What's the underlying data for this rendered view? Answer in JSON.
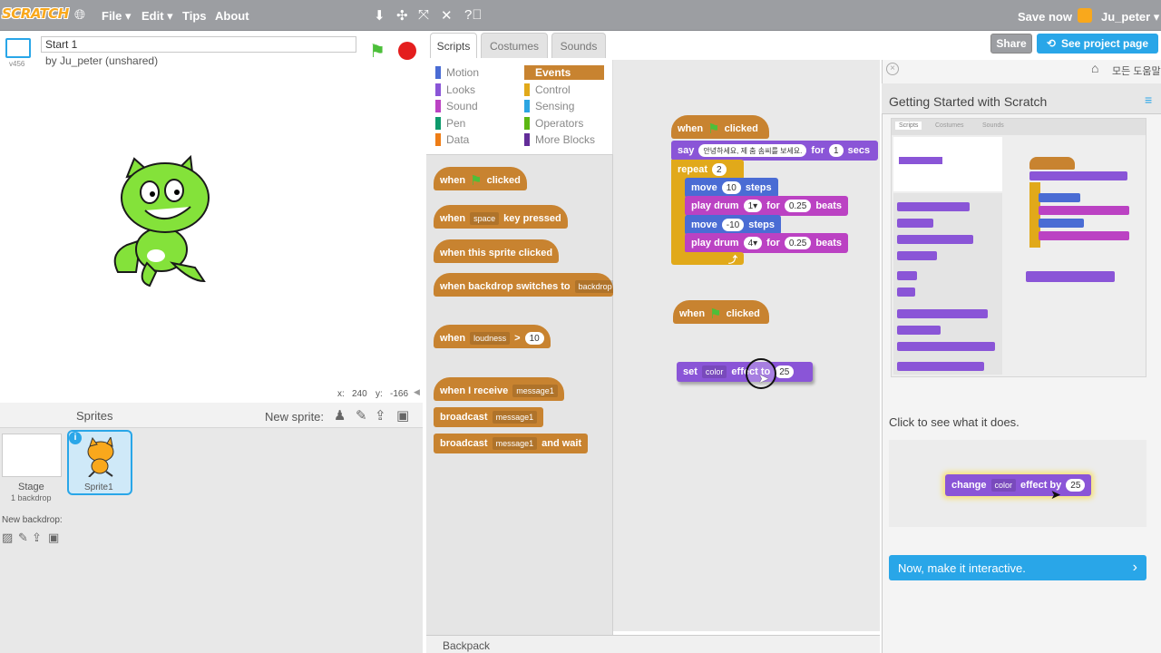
{
  "topbar": {
    "logo": "SCRATCH",
    "menus": [
      "File ▾",
      "Edit ▾",
      "Tips",
      "About"
    ],
    "save_now": "Save now",
    "username": "Ju_peter ▾"
  },
  "project": {
    "title_value": "Start 1",
    "byline": "by Ju_peter (unshared)",
    "version": "v456",
    "share_label": "Share",
    "see_project_label": "See project page"
  },
  "stage": {
    "x_label": "x:",
    "x_value": "240",
    "y_label": "y:",
    "y_value": "-166"
  },
  "sprites": {
    "header": "Sprites",
    "new_sprite": "New sprite:",
    "stage_label": "Stage",
    "stage_sub": "1 backdrop",
    "new_backdrop": "New backdrop:",
    "sprite1": "Sprite1"
  },
  "tabs": [
    "Scripts",
    "Costumes",
    "Sounds"
  ],
  "categories": {
    "left": [
      {
        "label": "Motion",
        "color": "#4a6cd4"
      },
      {
        "label": "Looks",
        "color": "#8a55d7"
      },
      {
        "label": "Sound",
        "color": "#bb42c3"
      },
      {
        "label": "Pen",
        "color": "#0e9a6c"
      },
      {
        "label": "Data",
        "color": "#ee7d16"
      }
    ],
    "right": [
      {
        "label": "Events",
        "color": "#c88330"
      },
      {
        "label": "Control",
        "color": "#e1a91a"
      },
      {
        "label": "Sensing",
        "color": "#2ca5e2"
      },
      {
        "label": "Operators",
        "color": "#5cb712"
      },
      {
        "label": "More Blocks",
        "color": "#632d99"
      }
    ]
  },
  "palette": {
    "when": "when",
    "clicked": "clicked",
    "space": "space",
    "key_pressed": "key pressed",
    "this_sprite_clicked": "when this sprite clicked",
    "backdrop_switches": "when backdrop switches to",
    "backdrop": "backdrop",
    "loudness": "loudness",
    "gt": ">",
    "ten": "10",
    "when_i_receive": "when I receive",
    "message1": "message1",
    "broadcast": "broadcast",
    "and_wait": "and wait"
  },
  "script": {
    "say": "say",
    "say_text": "안녕하세요, 제 춤 솜씨를 보세요.",
    "for": "for",
    "one": "1",
    "secs": "secs",
    "repeat": "repeat",
    "two": "2",
    "move": "move",
    "steps": "steps",
    "ten": "10",
    "neg_ten": "-10",
    "play_drum": "play drum",
    "drum1": "1▾",
    "drum4": "4▾",
    "beats_val": "0.25",
    "beats": "beats",
    "set": "set",
    "color": "color",
    "effect_to": "effect to",
    "twenty_five": "25"
  },
  "tips": {
    "help_home": "모든 도움말",
    "title": "Getting Started with Scratch",
    "click_see": "Click to see what it does.",
    "change": "change",
    "color": "color",
    "effect_by": "effect by",
    "value": "25",
    "next_button": "Now, make it interactive.",
    "arrow": "›",
    "thumb_tabs": [
      "Scripts",
      "Costumes",
      "Sounds"
    ]
  },
  "backpack": "Backpack",
  "colors": {
    "accent": "#29a6e8",
    "events": "#c88330",
    "topbar": "#9c9ea2",
    "cat_green": "#84e23a"
  }
}
